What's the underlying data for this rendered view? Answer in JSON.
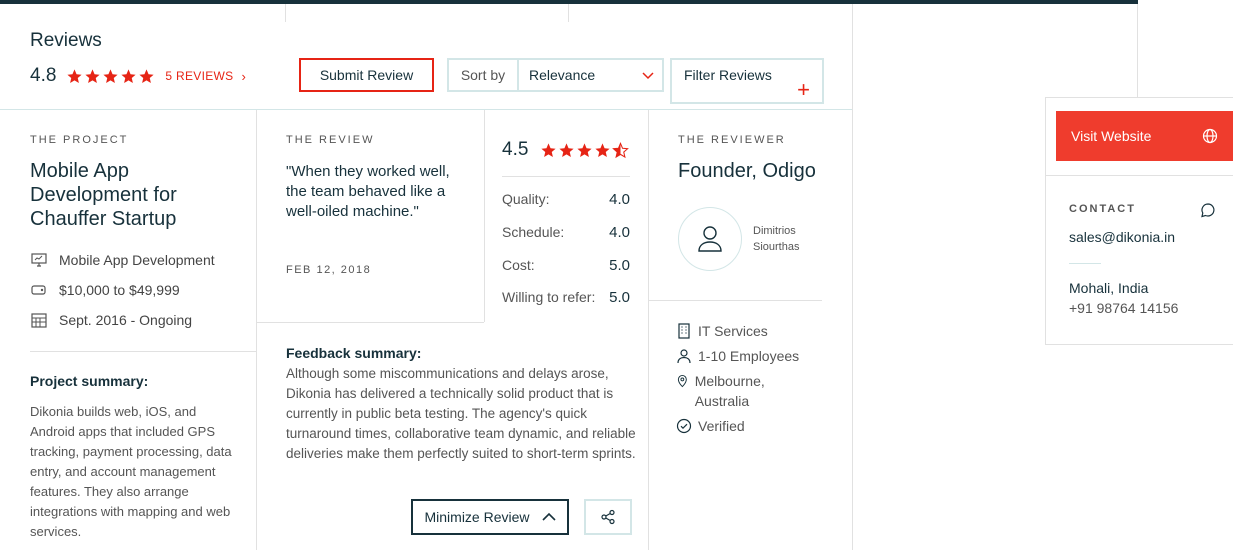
{
  "header": {
    "title": "Reviews",
    "rating": "4.8",
    "reviews_link": "5 REVIEWS",
    "reviews_chevron": "›",
    "submit_label": "Submit Review",
    "sort_label": "Sort by",
    "sort_value": "Relevance",
    "filter_label": "Filter Reviews",
    "filter_plus": "+"
  },
  "project": {
    "section_label": "THE PROJECT",
    "title": "Mobile App Development for Chauffer Startup",
    "service": "Mobile App Development",
    "budget": "$10,000 to $49,999",
    "dates": "Sept. 2016 - Ongoing",
    "summary_title": "Project summary:",
    "summary_text": "Dikonia builds web, iOS, and Android apps that included GPS tracking, payment processing, data entry, and account management features. They also arrange integrations with mapping and web services."
  },
  "review": {
    "section_label": "THE REVIEW",
    "quote": "\"When they worked well, the team behaved like a well-oiled machine.\"",
    "date": "FEB 12, 2018",
    "overall": "4.5",
    "scores": [
      {
        "label": "Quality:",
        "value": "4.0"
      },
      {
        "label": "Schedule:",
        "value": "4.0"
      },
      {
        "label": "Cost:",
        "value": "5.0"
      },
      {
        "label": "Willing to refer:",
        "value": "5.0"
      }
    ],
    "feedback_title": "Feedback summary:",
    "feedback_text": "Although some miscommunications and delays arose, Dikonia has delivered a technically solid product that is currently in public beta testing. The agency's quick turnaround times, collaborative team dynamic, and reliable deliveries make them perfectly suited to short-term sprints.",
    "minimize_label": "Minimize Review"
  },
  "reviewer": {
    "section_label": "THE REVIEWER",
    "title": "Founder, Odigo",
    "name": "Dimitrios Siourthas",
    "industry": "IT Services",
    "size": "1-10 Employees",
    "location": "Melbourne, Australia",
    "status": "Verified"
  },
  "sidebar": {
    "visit_label": "Visit Website",
    "contact_label": "CONTACT",
    "email": "sales@dikonia.in",
    "location": "Mohali, India",
    "phone": "+91 98764 14156"
  },
  "colors": {
    "accent": "#e62415",
    "visit_button": "#ef3c2d",
    "navy": "#17313b",
    "border_light": "#d3e6e7"
  },
  "icons": [
    "star-icon",
    "chevron-right-icon",
    "chevron-down-icon",
    "plus-icon",
    "monitor-icon",
    "tag-icon",
    "calendar-icon",
    "chevron-up-icon",
    "share-icon",
    "user-icon",
    "building-icon",
    "people-icon",
    "location-pin-icon",
    "check-circle-icon",
    "globe-icon",
    "chat-icon"
  ]
}
